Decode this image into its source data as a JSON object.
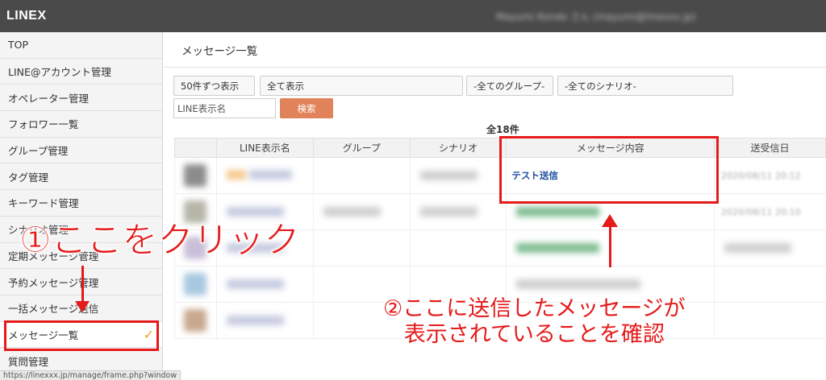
{
  "app": {
    "brand": "LINEX",
    "user_info": "Mayumi Kondo さん (mayumi@linexxx.jp)"
  },
  "sidebar": {
    "items": [
      {
        "label": "TOP"
      },
      {
        "label": "LINE@アカウント管理"
      },
      {
        "label": "オペレーター管理"
      },
      {
        "label": "フォロワー一覧"
      },
      {
        "label": "グループ管理"
      },
      {
        "label": "タグ管理"
      },
      {
        "label": "キーワード管理"
      },
      {
        "label": "シナリオ管理"
      },
      {
        "label": "定期メッセージ管理"
      },
      {
        "label": "予約メッセージ管理"
      },
      {
        "label": "一括メッセージ送信"
      },
      {
        "label": "メッセージ一覧",
        "active": true
      },
      {
        "label": "質問管理"
      }
    ]
  },
  "main": {
    "title": "メッセージ一覧",
    "filters": {
      "per_page": "50件ずつ表示",
      "display_all": "全て表示",
      "group_select": "-全てのグループ-",
      "scenario_select": "-全てのシナリオ-",
      "name_placeholder": "LINE表示名",
      "search_label": "検索"
    },
    "total": "全18件",
    "table": {
      "headers": [
        "",
        "LINE表示名",
        "グループ",
        "シナリオ",
        "メッセージ内容",
        "送受信日"
      ],
      "first_row": {
        "message": "テスト送信",
        "date": "2020/08/11 20:12"
      },
      "second_row": {
        "date": "2020/08/11 20:10"
      }
    }
  },
  "annotations": {
    "step1": "①ここをクリック",
    "step2_line1": "②ここに送信したメッセージが",
    "step2_line2": "表示されていることを確認",
    "color": "#e51a1a"
  },
  "statusbar": {
    "url": "https://linexxx.jp/manage/frame.php?window"
  }
}
